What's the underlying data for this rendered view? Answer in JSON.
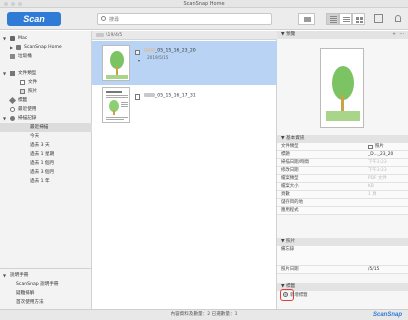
{
  "window": {
    "title": "ScanSnap Home"
  },
  "toolbar": {
    "scan_label": "Scan",
    "search_placeholder": "搜尋"
  },
  "sidebar": {
    "items": [
      {
        "label": "Mac"
      },
      {
        "label": "ScanSnap Home"
      },
      {
        "label": "垃圾桶"
      },
      {
        "label": "文件類型"
      },
      {
        "label": "文件"
      },
      {
        "label": "照片"
      },
      {
        "label": "標籤"
      },
      {
        "label": "最近使用"
      },
      {
        "label": "掃描記錄"
      },
      {
        "label": "最近掃描"
      },
      {
        "label": "今天"
      },
      {
        "label": "過去 3 天"
      },
      {
        "label": "過去 1 星期"
      },
      {
        "label": "過去 1 個月"
      },
      {
        "label": "過去 3 個月"
      },
      {
        "label": "過去 1 年"
      }
    ],
    "bottom": [
      {
        "label": "說明手冊"
      },
      {
        "label": "ScanSnap 說明手冊"
      },
      {
        "label": "疑難排解"
      },
      {
        "label": "首次使用方法"
      }
    ]
  },
  "filelist": {
    "path": "\\19/4/5",
    "rows": [
      {
        "name": "_05_15_16_23_20",
        "date": "2019/5/15"
      },
      {
        "name": "_05_15_16_17_31",
        "date": ""
      }
    ]
  },
  "panel": {
    "preview_label": "預覽",
    "basic_label": "基本資訊",
    "basic": [
      {
        "k": "文件類型",
        "v": "照片"
      },
      {
        "k": "標題",
        "v": "_D..._23_20"
      },
      {
        "k": "掃描日期/時間",
        "v": "下午3:23"
      },
      {
        "k": "修改日期",
        "v": "下午3:23"
      },
      {
        "k": "檔案類型",
        "v": "PDF 文件"
      },
      {
        "k": "檔案大小",
        "v": "KB"
      },
      {
        "k": "頁數",
        "v": "1 頁"
      },
      {
        "k": "儲存目的地",
        "v": ""
      },
      {
        "k": "應用程式",
        "v": ""
      }
    ],
    "photo_label": "照片",
    "photo": [
      {
        "k": "備忘錄",
        "v": ""
      },
      {
        "k": "照片日期",
        "v": "/5/15"
      }
    ],
    "tag_label": "標籤",
    "add_tag": "新增標籤"
  },
  "status": {
    "text": "內容資料及數量：2 已選數量：1",
    "logo": "ScanSnap"
  }
}
